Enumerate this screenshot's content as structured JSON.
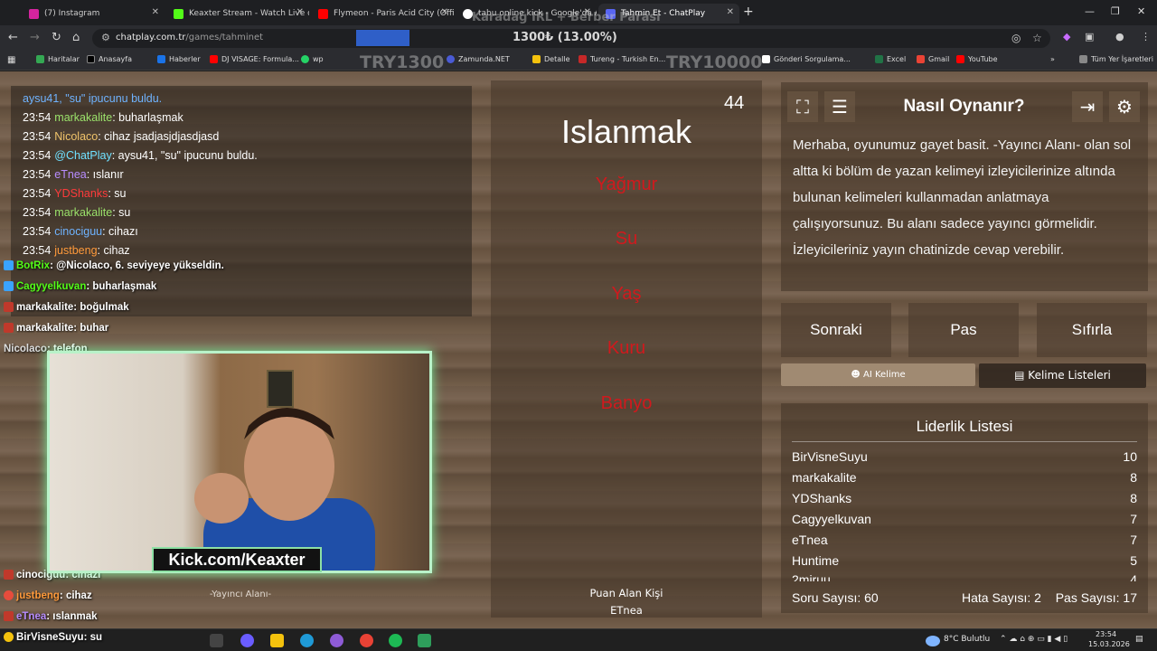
{
  "browser": {
    "tabs": [
      {
        "title": "(7) Instagram",
        "color": "#d6249f"
      },
      {
        "title": "Keaxter Stream - Watch Live on",
        "color": "#53fc18"
      },
      {
        "title": "Flymeon - Paris Acid City (Offic",
        "color": "#ff0000"
      },
      {
        "title": "tabu online kick - Google'da A",
        "color": "#ffffff"
      },
      {
        "title": "Tahmin Et - ChatPlay",
        "color": "#5865f2"
      }
    ],
    "url_host": "chatplay.com.tr",
    "url_path": "/games/tahminet",
    "zoom_text": "1300₺ (13.00%)",
    "bookmarks": [
      {
        "label": "Haritalar",
        "color": "#34a853"
      },
      {
        "label": "Anasayfa",
        "color": "#000000"
      },
      {
        "label": "Haberler",
        "color": "#1a73e8"
      },
      {
        "label": "DJ VISAGE: Formula...",
        "color": "#ff0000"
      },
      {
        "label": "wp",
        "color": "#25d366"
      },
      {
        "label": "Zamunda.NET",
        "color": "#4a5bd6"
      },
      {
        "label": "Detalle",
        "color": "#f4c20d"
      },
      {
        "label": "Tureng - Turkish En...",
        "color": "#c62828"
      },
      {
        "label": "Gönderi Sorgulama...",
        "color": "#ffffff"
      },
      {
        "label": "Excel",
        "color": "#217346"
      },
      {
        "label": "Gmail",
        "color": "#ea4335"
      },
      {
        "label": "YouTube",
        "color": "#ff0000"
      }
    ],
    "all_bookmarks": "Tüm Yer İşaretleri"
  },
  "ghost_text": {
    "top": "Karadağ IRL + Berber Parası",
    "left": "TRY1300",
    "right": "TRY10000"
  },
  "chat": [
    {
      "time": "",
      "nick": "aysu41,",
      "nick_color": "#6fb3ff",
      "text": "\"su\" ipucunu buldu."
    },
    {
      "time": "23:54",
      "nick": "markakalite",
      "nick_color": "#9be36b",
      "text": ": buharlaşmak"
    },
    {
      "time": "23:54",
      "nick": "Nicolaco",
      "nick_color": "#f0c36a",
      "text": ": cihaz jsadjasjdjasdjasd"
    },
    {
      "time": "23:54",
      "nick": "@ChatPlay",
      "nick_color": "#6fe0ff",
      "text": ": aysu41, \"su\" ipucunu buldu."
    },
    {
      "time": "23:54",
      "nick": "eTnea",
      "nick_color": "#b78cff",
      "text": ": ıslanır"
    },
    {
      "time": "23:54",
      "nick": "YDShanks",
      "nick_color": "#ff3b3b",
      "text": ": su"
    },
    {
      "time": "23:54",
      "nick": "markakalite",
      "nick_color": "#9be36b",
      "text": ": su"
    },
    {
      "time": "23:54",
      "nick": "cinociguu",
      "nick_color": "#6fb3ff",
      "text": ": cihazı"
    },
    {
      "time": "23:54",
      "nick": "justbeng",
      "nick_color": "#ff9a3b",
      "text": ": cihaz"
    }
  ],
  "game": {
    "timer": "44",
    "word": "Islanmak",
    "forbidden": [
      "Yağmur",
      "Su",
      "Yaş",
      "Kuru",
      "Banyo"
    ],
    "scorer_label": "Puan Alan Kişi",
    "scorer_name": "ETnea"
  },
  "info": {
    "title": "Nasıl Oynanır?",
    "text": "Merhaba, oyunumuz gayet basit. -Yayıncı Alanı- olan sol altta ki bölüm de yazan kelimeyi izleyicilerinize altında bulunan kelimeleri kullanmadan anlatmaya çalışıyorsunuz. Bu alanı sadece yayıncı görmelidir. İzleyicileriniz yayın chatinizde cevap verebilir."
  },
  "buttons": {
    "next": "Sonraki",
    "pass": "Pas",
    "reset": "Sıfırla",
    "ai_word": "AI Kelime",
    "word_lists": "Kelime Listeleri"
  },
  "leaderboard": {
    "title": "Liderlik Listesi",
    "rows": [
      {
        "name": "BirVisneSuyu",
        "score": "10"
      },
      {
        "name": "markakalite",
        "score": "8"
      },
      {
        "name": "YDShanks",
        "score": "8"
      },
      {
        "name": "Cagyyelkuvan",
        "score": "7"
      },
      {
        "name": "eTnea",
        "score": "7"
      },
      {
        "name": "Huntime",
        "score": "5"
      },
      {
        "name": "2miruu",
        "score": "4"
      }
    ],
    "question_count": "Soru Sayısı: 60",
    "error_count": "Hata Sayısı: 2",
    "pass_count": "Pas Sayısı: 17"
  },
  "stream_chat": [
    {
      "nick": "BotRix",
      "nick_color": "#53fc18",
      "text": ": @Nicolaco, 6. seviyeye yükseldin."
    },
    {
      "nick": "Cagyyelkuvan",
      "nick_color": "#53fc18",
      "text": ": buharlaşmak"
    },
    {
      "nick": "markakalite",
      "nick_color": "#ffffff",
      "text": ": boğulmak"
    },
    {
      "nick": "markakalite",
      "nick_color": "#ffffff",
      "text": ": buhar"
    },
    {
      "nick": "Nicolaco",
      "nick_color": "#dddddd",
      "text": ": telefon"
    },
    {
      "nick": "cinociguu",
      "nick_color": "#ffffff",
      "text": ": cihazı"
    },
    {
      "nick": "justbeng",
      "nick_color": "#ff9a3b",
      "text": ": cihaz"
    },
    {
      "nick": "eTnea",
      "nick_color": "#b78cff",
      "text": ": ıslanmak"
    },
    {
      "nick": "BirVisneSuyu",
      "nick_color": "#ffffff",
      "text": ": su"
    }
  ],
  "webcam": {
    "label": "Kick.com/Keaxter",
    "area_label": "-Yayıncı Alanı-"
  },
  "taskbar": {
    "weather": "8°C Bulutlu",
    "time": "23:54",
    "date": "15.03.2026"
  }
}
